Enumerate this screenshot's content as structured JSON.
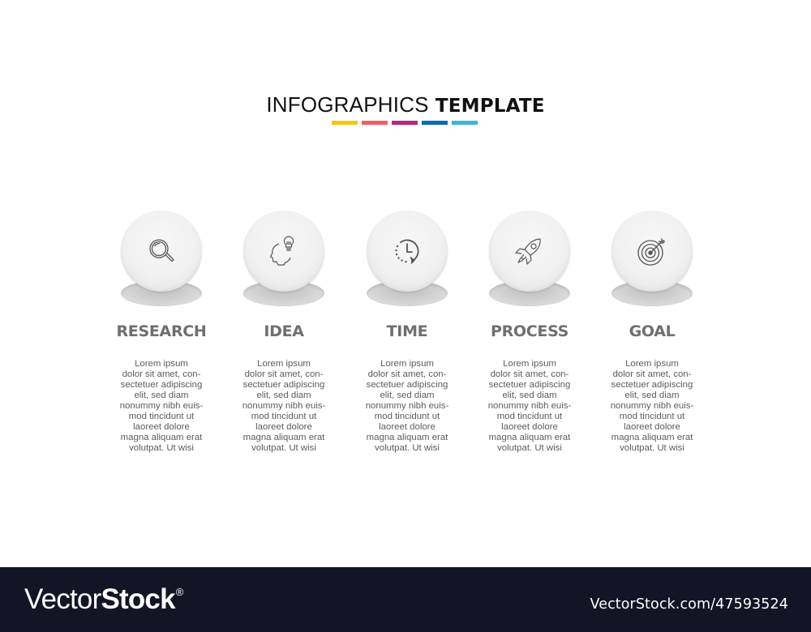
{
  "header": {
    "title_light": "INFOGRAPHICS",
    "title_bold": "TEMPLATE",
    "accent_colors": [
      "#f5c518",
      "#f25c66",
      "#b5287a",
      "#0a6ab3",
      "#3cb6d3"
    ]
  },
  "steps": [
    {
      "label": "RESEARCH",
      "icon": "magnifier-icon",
      "description": [
        "Lorem ipsum",
        "dolor sit amet, con-",
        "sectetuer adipiscing",
        "elit, sed diam",
        "nonummy nibh euis-",
        "mod tincidunt ut",
        "laoreet dolore",
        "magna aliquam erat",
        "volutpat. Ut wisi"
      ]
    },
    {
      "label": "IDEA",
      "icon": "head-lightbulb-icon",
      "description": [
        "Lorem ipsum",
        "dolor sit amet, con-",
        "sectetuer adipiscing",
        "elit, sed diam",
        "nonummy nibh euis-",
        "mod tincidunt ut",
        "laoreet dolore",
        "magna aliquam erat",
        "volutpat. Ut wisi"
      ]
    },
    {
      "label": "TIME",
      "icon": "clock-history-icon",
      "description": [
        "Lorem ipsum",
        "dolor sit amet, con-",
        "sectetuer adipiscing",
        "elit, sed diam",
        "nonummy nibh euis-",
        "mod tincidunt ut",
        "laoreet dolore",
        "magna aliquam erat",
        "volutpat. Ut wisi"
      ]
    },
    {
      "label": "PROCESS",
      "icon": "rocket-icon",
      "description": [
        "Lorem ipsum",
        "dolor sit amet, con-",
        "sectetuer adipiscing",
        "elit, sed diam",
        "nonummy nibh euis-",
        "mod tincidunt ut",
        "laoreet dolore",
        "magna aliquam erat",
        "volutpat. Ut wisi"
      ]
    },
    {
      "label": "GOAL",
      "icon": "target-icon",
      "description": [
        "Lorem ipsum",
        "dolor sit amet, con-",
        "sectetuer adipiscing",
        "elit, sed diam",
        "nonummy nibh euis-",
        "mod tincidunt ut",
        "laoreet dolore",
        "magna aliquam erat",
        "volutpat. Ut wisi"
      ]
    }
  ],
  "footer": {
    "brand_light": "Vector",
    "brand_bold": "Stock",
    "brand_mark": "®",
    "url": "VectorStock.com/47593524",
    "background": "#131426"
  }
}
